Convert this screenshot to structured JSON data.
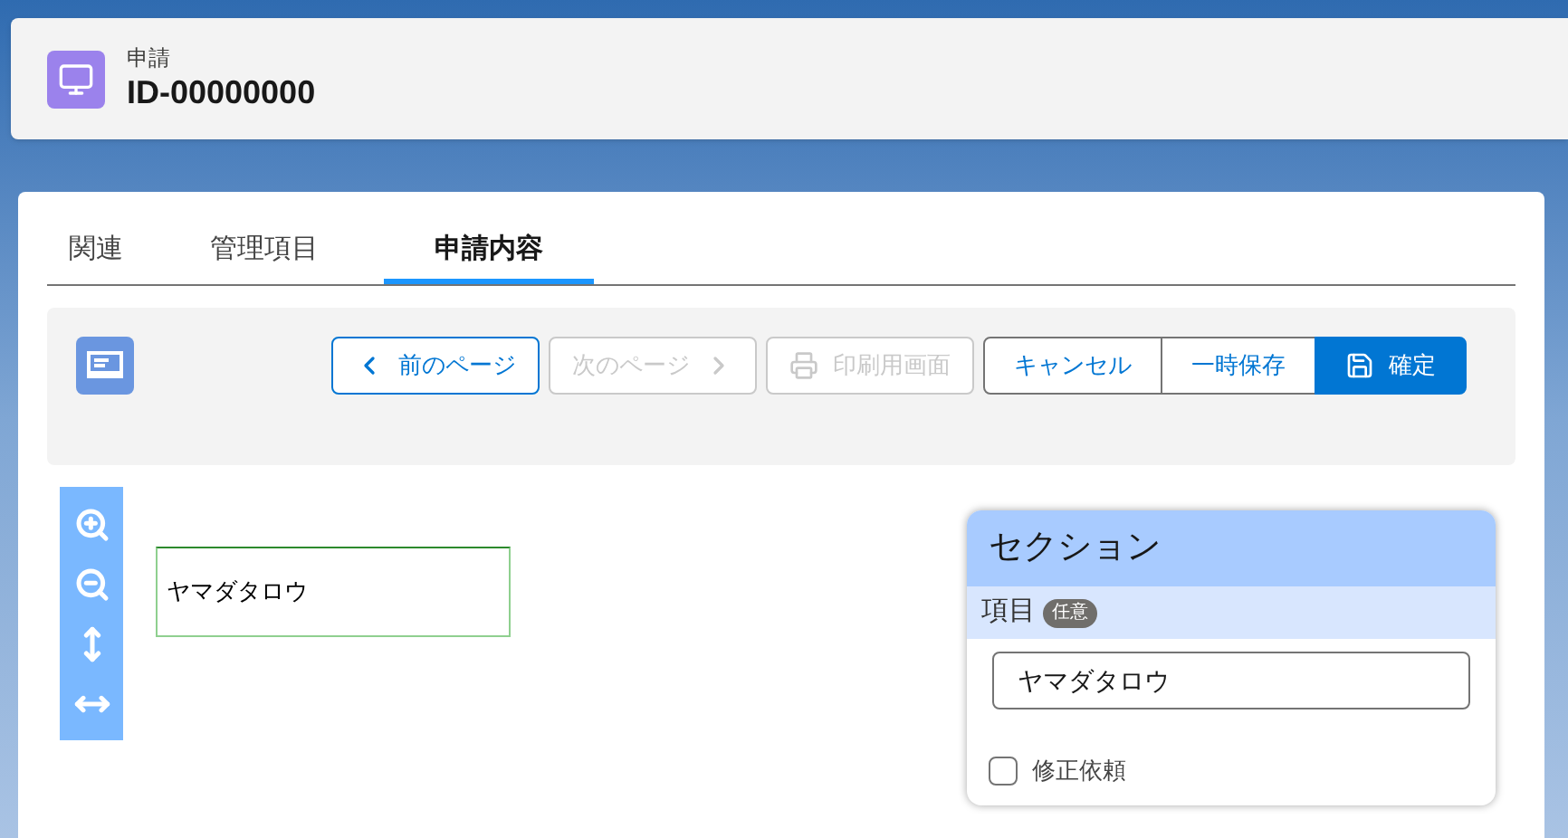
{
  "header": {
    "object_label": "申請",
    "record_title": "ID-00000000"
  },
  "tabs": [
    {
      "label": "関連",
      "selected": false
    },
    {
      "label": "管理項目",
      "selected": false
    },
    {
      "label": "申請内容",
      "selected": true
    }
  ],
  "toolbar_buttons": [
    {
      "kind": "prev",
      "label": "前のページ",
      "disabled": false
    },
    {
      "kind": "next",
      "label": "次のページ",
      "disabled": true
    },
    {
      "kind": "print",
      "label": "印刷用画面",
      "disabled": true
    }
  ],
  "action_buttons": [
    {
      "kind": "plain",
      "label": "キャンセル"
    },
    {
      "kind": "plain",
      "label": "一時保存"
    },
    {
      "kind": "primary",
      "label": "確定"
    }
  ],
  "canvas_field": {
    "value": "ヤマダタロウ"
  },
  "section": {
    "title": "セクション",
    "field_label": "項目",
    "badge": "任意",
    "field_value": "ヤマダタロウ",
    "checkbox": {
      "label": "修正依頼",
      "checked": false
    }
  }
}
